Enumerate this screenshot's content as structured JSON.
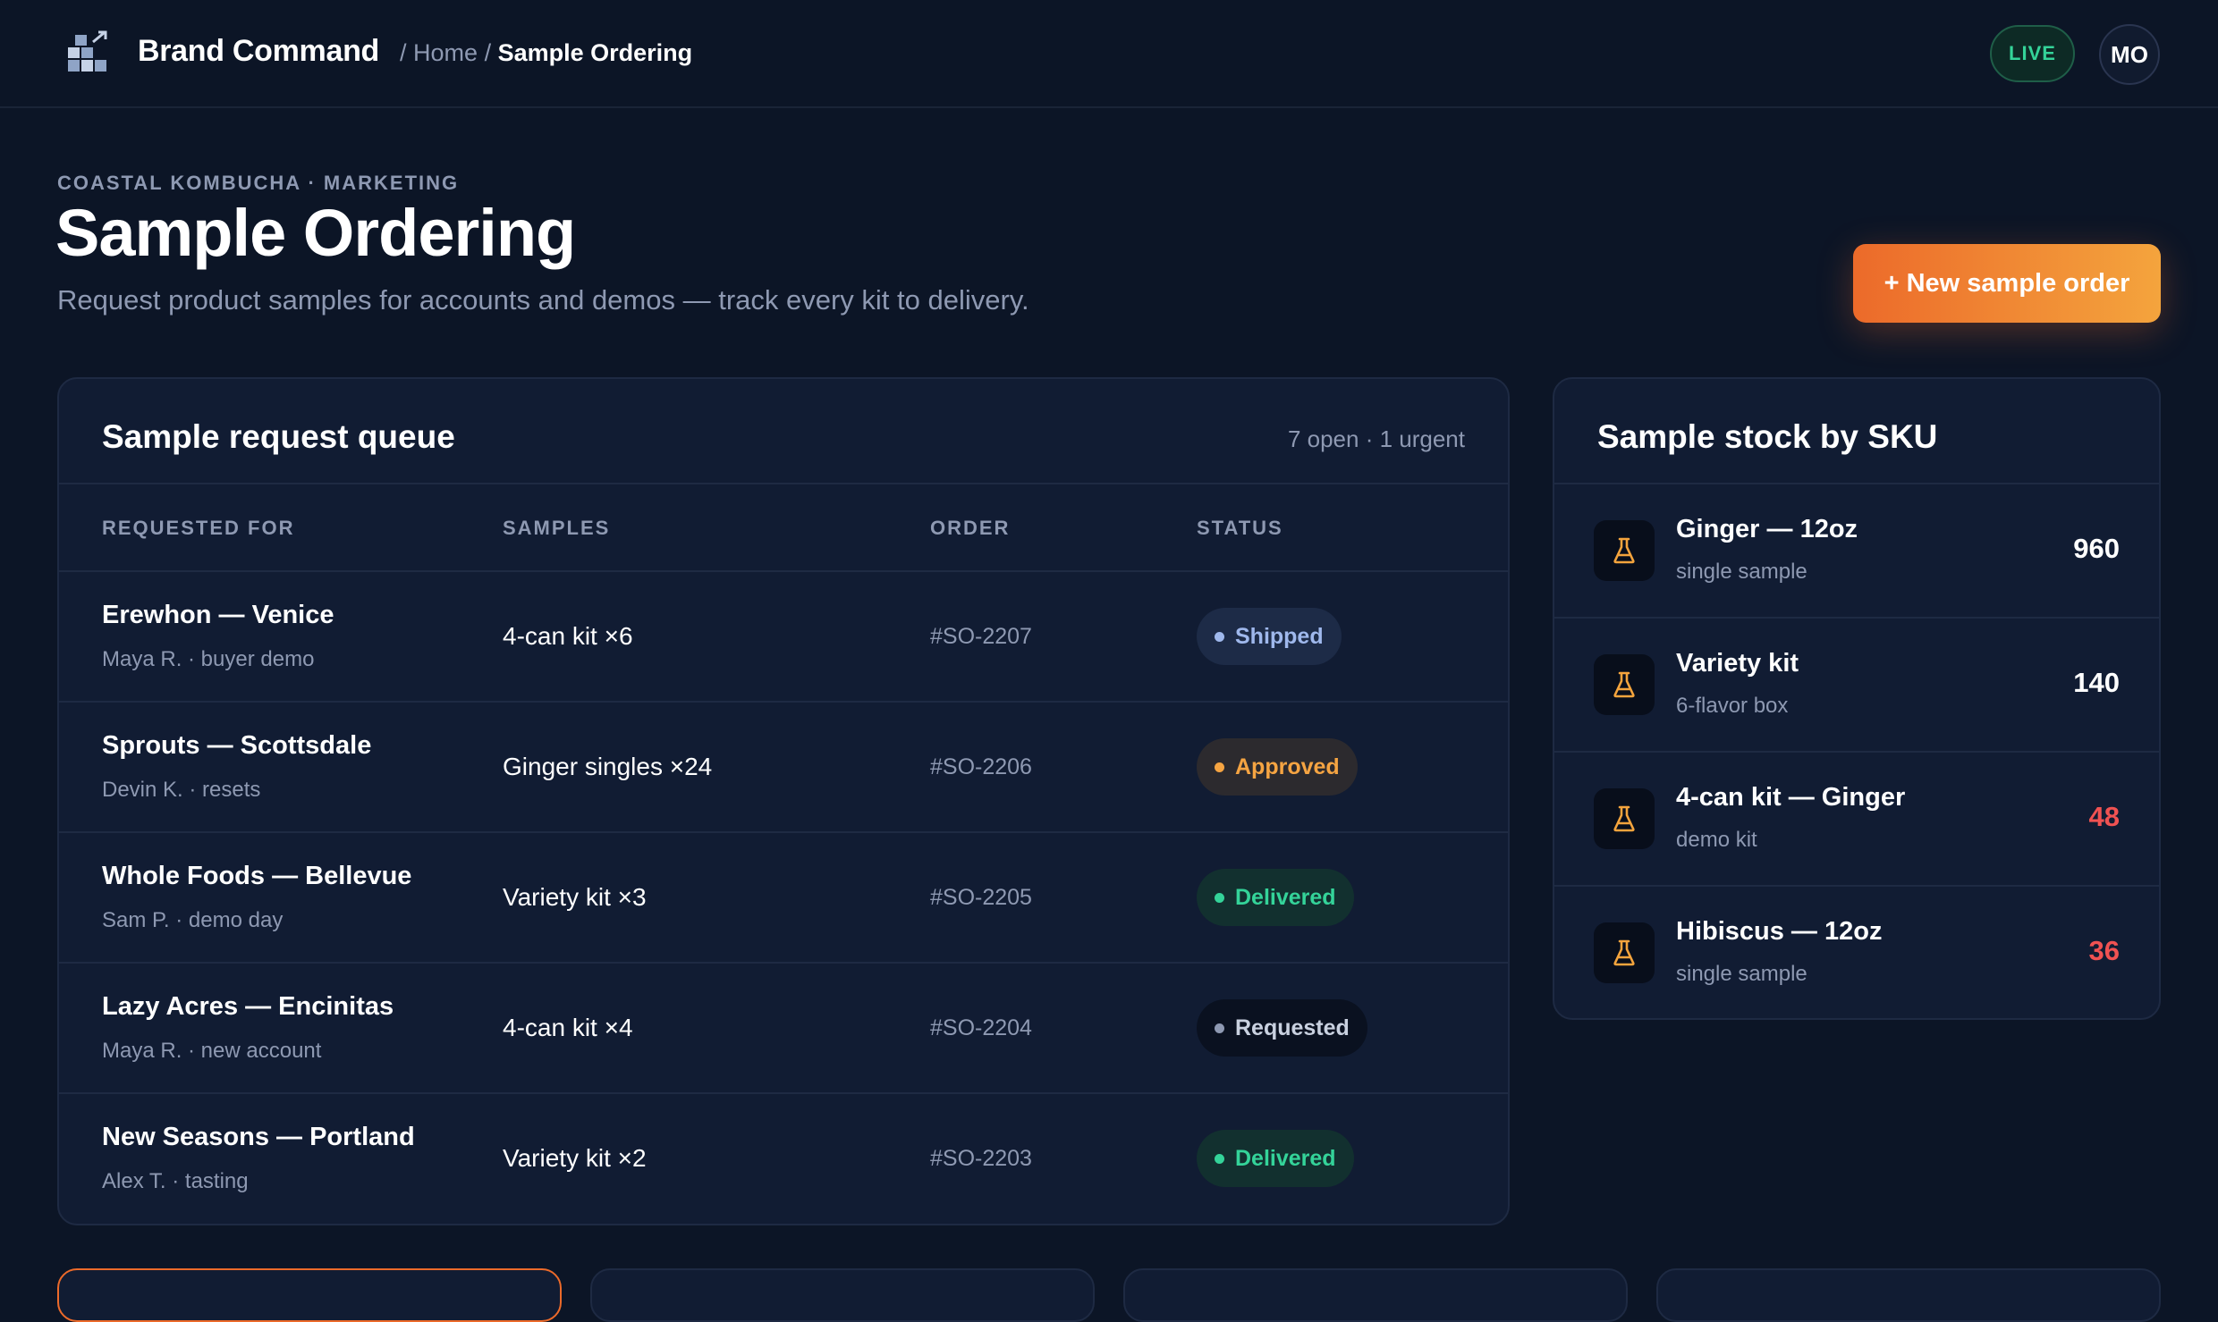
{
  "app": {
    "name": "Brand Command",
    "live_label": "LIVE",
    "user_initials": "MO"
  },
  "breadcrumb": {
    "sep1": "/",
    "home": "Home",
    "sep2": "/",
    "current": "Sample Ordering"
  },
  "header": {
    "eyebrow": "COASTAL KOMBUCHA · MARKETING",
    "title": "Sample Ordering",
    "subtitle": "Request product samples for accounts and demos — track every kit to delivery.",
    "new_order_label": "+ New sample order"
  },
  "queue": {
    "title": "Sample request queue",
    "meta": "7 open · 1 urgent",
    "columns": [
      "REQUESTED FOR",
      "SAMPLES",
      "ORDER",
      "STATUS"
    ],
    "rows": [
      {
        "account": "Erewhon — Venice",
        "detail": "Maya R. · buyer demo",
        "samples": "4-can kit ×6",
        "order": "#SO-2207",
        "status": "Shipped",
        "status_key": "shipped"
      },
      {
        "account": "Sprouts — Scottsdale",
        "detail": "Devin K. · resets",
        "samples": "Ginger singles ×24",
        "order": "#SO-2206",
        "status": "Approved",
        "status_key": "approved"
      },
      {
        "account": "Whole Foods — Bellevue",
        "detail": "Sam P. · demo day",
        "samples": "Variety kit ×3",
        "order": "#SO-2205",
        "status": "Delivered",
        "status_key": "delivered"
      },
      {
        "account": "Lazy Acres — Encinitas",
        "detail": "Maya R. · new account",
        "samples": "4-can kit ×4",
        "order": "#SO-2204",
        "status": "Requested",
        "status_key": "requested"
      },
      {
        "account": "New Seasons — Portland",
        "detail": "Alex T. · tasting",
        "samples": "Variety kit ×2",
        "order": "#SO-2203",
        "status": "Delivered",
        "status_key": "delivered"
      }
    ]
  },
  "stock": {
    "title": "Sample stock by SKU",
    "items": [
      {
        "name": "Ginger — 12oz",
        "detail": "single sample",
        "qty": "960",
        "low": false,
        "icon": "flask-icon"
      },
      {
        "name": "Variety kit",
        "detail": "6-flavor box",
        "qty": "140",
        "low": false,
        "icon": "flask-icon"
      },
      {
        "name": "4-can kit — Ginger",
        "detail": "demo kit",
        "qty": "48",
        "low": true,
        "icon": "flask-icon"
      },
      {
        "name": "Hibiscus — 12oz",
        "detail": "single sample",
        "qty": "36",
        "low": true,
        "icon": "flask-icon"
      }
    ]
  },
  "colors": {
    "background": "#0c1526",
    "panel": "#111c33",
    "accent_start": "#ec6a2a",
    "accent_end": "#f4a43d",
    "live_green": "#34d399",
    "low_stock_red": "#f05252",
    "approved_amber": "#f5a442",
    "shipped_blue": "#9fb8ec"
  }
}
